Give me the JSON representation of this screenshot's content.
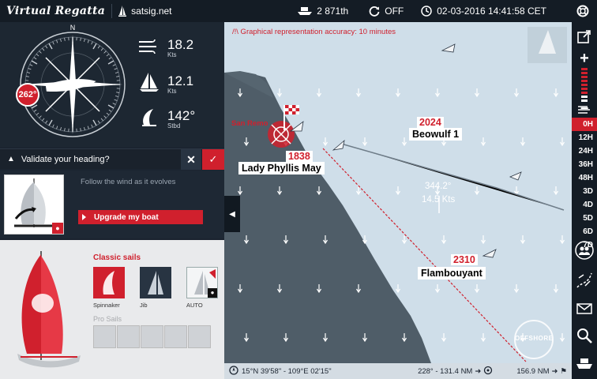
{
  "topbar": {
    "logo": "Virtual Regatta",
    "site": "satsig.net",
    "rank": "2 871th",
    "sync_state": "OFF",
    "datetime": "02-03-2016 14:41:58 CET"
  },
  "navigation": {
    "heading_badge": "262°",
    "wind_speed": "18.2",
    "wind_speed_unit": "Kts",
    "boat_speed": "12.1",
    "boat_speed_unit": "Kts",
    "twa": "142°",
    "twa_side": "Stbd"
  },
  "validate": {
    "question": "Validate your heading?",
    "cancel_glyph": "✕",
    "ok_glyph": "✓"
  },
  "sail_panel": {
    "follow_text": "Follow the wind as it evolves",
    "upgrade_label": "Upgrade my boat"
  },
  "sails": {
    "title": "Classic sails",
    "items": [
      {
        "label": "Spinnaker"
      },
      {
        "label": "Jib"
      },
      {
        "label": "AUTO"
      }
    ],
    "pro_title": "Pro Sails"
  },
  "map": {
    "accuracy_note": "/!\\ Graphical representation accuracy: 10 minutes",
    "port_name": "San Remo",
    "wind_direction": "344.2°",
    "wind_speed": "14.5 Kts",
    "boats": [
      {
        "rank": "1838",
        "name": "Lady Phyllis May"
      },
      {
        "rank": "2024",
        "name": "Beowulf 1"
      },
      {
        "rank": "2310",
        "name": "Flambouyant"
      }
    ],
    "watermark": "OFFSHORE"
  },
  "status": {
    "coordinates": "15°N 39'58\" - 109°E 02'15\"",
    "bearing_distance": "228° - 131.4 NM",
    "finish_distance": "156.9 NM"
  },
  "timeline": {
    "items": [
      "0H",
      "12H",
      "24H",
      "36H",
      "48H",
      "3D",
      "4D",
      "5D",
      "6D",
      "7D"
    ],
    "active": "0H"
  },
  "colors": {
    "accent": "#d0202d",
    "panel_dark": "#1b2430",
    "sea": "#cfdee9",
    "land": "#4f5d68"
  }
}
